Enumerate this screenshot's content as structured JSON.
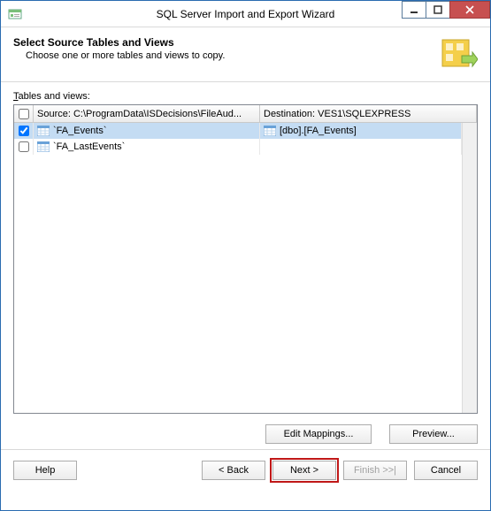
{
  "window": {
    "title": "SQL Server Import and Export Wizard"
  },
  "header": {
    "title": "Select Source Tables and Views",
    "subtitle": "Choose one or more tables and views to copy."
  },
  "grid": {
    "label_pre": "T",
    "label_post": "ables and views:",
    "columns": {
      "source": "Source: C:\\ProgramData\\ISDecisions\\FileAud...",
      "destination": "Destination: VES1\\SQLEXPRESS"
    },
    "rows": [
      {
        "checked": true,
        "selected": true,
        "source": "`FA_Events`",
        "destination": "[dbo].[FA_Events]"
      },
      {
        "checked": false,
        "selected": false,
        "source": "`FA_LastEvents`",
        "destination": ""
      }
    ]
  },
  "buttons": {
    "edit_mappings": "Edit Mappings...",
    "preview": "Preview...",
    "help": "Help",
    "back": "< Back",
    "next": "Next >",
    "finish": "Finish >>|",
    "cancel": "Cancel"
  }
}
